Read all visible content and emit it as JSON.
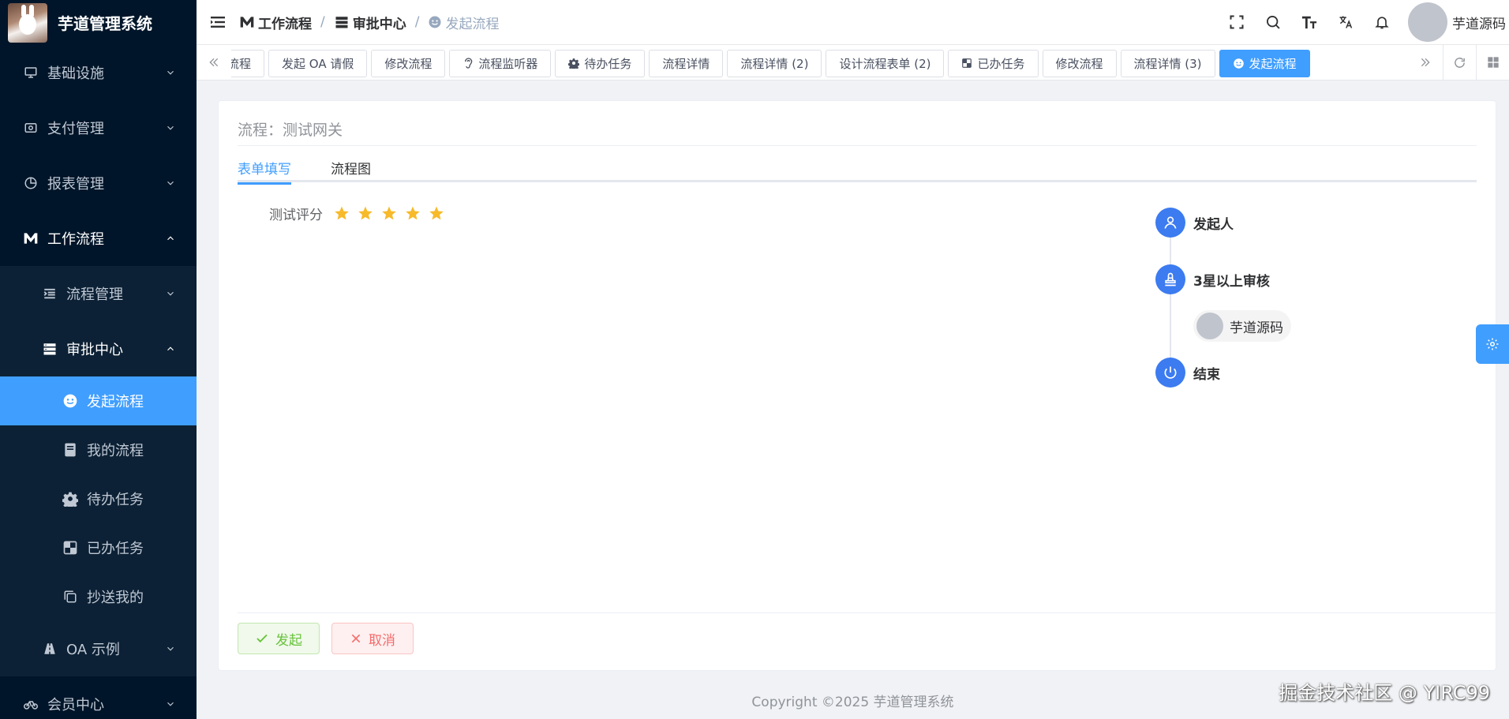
{
  "app": {
    "title": "芋道管理系统"
  },
  "sidebar": {
    "items": [
      {
        "label": "基础设施",
        "icon": "monitor-icon"
      },
      {
        "label": "支付管理",
        "icon": "wallet-icon"
      },
      {
        "label": "报表管理",
        "icon": "pie-chart-icon"
      },
      {
        "label": "工作流程",
        "icon": "workflow-icon"
      }
    ],
    "workflow_children": [
      {
        "label": "流程管理",
        "icon": "list-indent-icon"
      },
      {
        "label": "审批中心",
        "icon": "server-icon"
      }
    ],
    "approval_children": [
      {
        "label": "发起流程",
        "icon": "smile-icon",
        "active": true
      },
      {
        "label": "我的流程",
        "icon": "book-icon"
      },
      {
        "label": "待办任务",
        "icon": "gear-icon"
      },
      {
        "label": "已办任务",
        "icon": "checkerboard-icon"
      },
      {
        "label": "抄送我的",
        "icon": "copy-icon"
      }
    ],
    "oa": {
      "label": "OA 示例",
      "icon": "road-icon"
    },
    "member": {
      "label": "会员中心",
      "icon": "bike-icon"
    }
  },
  "header": {
    "breadcrumb": [
      "工作流程",
      "审批中心",
      "发起流程"
    ],
    "username": "芋道源码"
  },
  "tags": [
    {
      "label": "流程",
      "icon": ""
    },
    {
      "label": "发起 OA 请假",
      "icon": ""
    },
    {
      "label": "修改流程",
      "icon": ""
    },
    {
      "label": "流程监听器",
      "icon": "ear-icon"
    },
    {
      "label": "待办任务",
      "icon": "gear-icon"
    },
    {
      "label": "流程详情",
      "icon": ""
    },
    {
      "label": "流程详情 (2)",
      "icon": ""
    },
    {
      "label": "设计流程表单 (2)",
      "icon": ""
    },
    {
      "label": "已办任务",
      "icon": "checkerboard-icon"
    },
    {
      "label": "修改流程",
      "icon": ""
    },
    {
      "label": "流程详情 (3)",
      "icon": ""
    },
    {
      "label": "发起流程",
      "icon": "smile-icon",
      "active": true
    }
  ],
  "card": {
    "title": "流程：测试网关",
    "tabs": [
      "表单填写",
      "流程图"
    ],
    "rate_label": "测试评分",
    "rating": {
      "value": 5,
      "max": 5
    }
  },
  "timeline": {
    "start": "发起人",
    "review": "3星以上审核",
    "reviewer": "芋道源码",
    "end": "结束"
  },
  "buttons": {
    "submit": "发起",
    "cancel": "取消"
  },
  "footer": {
    "copyright": "Copyright ©2025 芋道管理系统"
  },
  "watermark": "掘金技术社区 @ YIRC99",
  "colors": {
    "primary": "#409eff",
    "sidebar": "#001529",
    "star": "#f7ba2a",
    "success": "#67c23a",
    "danger": "#f56c6c"
  }
}
